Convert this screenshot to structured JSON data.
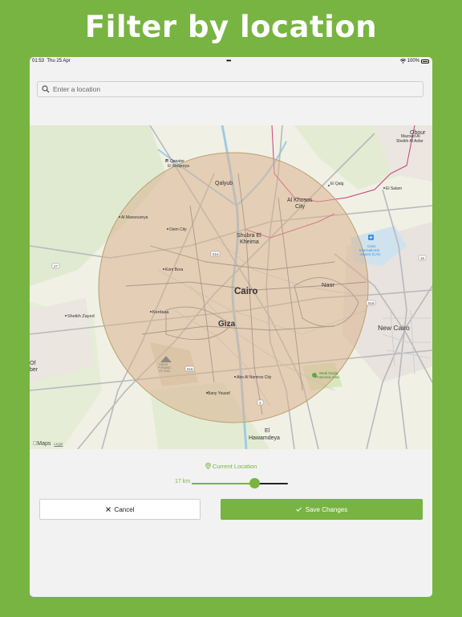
{
  "headline": "Filter by location",
  "status": {
    "time": "01:53",
    "date": "Thu 25 Apr",
    "dots": "•••",
    "battery": "100%"
  },
  "search": {
    "placeholder": "Enter a location",
    "value": ""
  },
  "map": {
    "places": {
      "cairo": "Cairo",
      "giza": "Giza",
      "new_cairo": "New Cairo",
      "nasr": "Nasr",
      "qalyub": "Qalyub",
      "el_khosos_1": "Al Khosos",
      "el_khosos_2": "City",
      "shubra_1": "Shubra El",
      "shubra_2": "Kheima",
      "hawamdeya_1": "El",
      "hawamdeya_2": "Hawamdeya",
      "kerdasa": "Kerdasa",
      "sheikh_zayed": "Sheikh Zayed",
      "obour": "Obour",
      "el_qanater_1": "El Qanater",
      "el_qanater_2": "El Khayreya",
      "al_mansoureya": "Al Mansoureya",
      "osim": "Osim City",
      "kom_bora": "Kom Bora",
      "abo_al_nomros": "Abo Al Nomros City",
      "bany_yousef": "Bany Yousef",
      "el_qalg": "El Qalg",
      "el_salam": "El Salam",
      "mazraet_1": "Mazraet Al",
      "mazraet_2": "Sheikh Al Asfar",
      "airport_1": "Cairo",
      "airport_2": "International",
      "airport_3": "Airport (CAI)",
      "wadi_1": "Wadi Degla",
      "wadi_2": "Protected Area",
      "pyramid_1": "GREAT",
      "pyramid_2": "PYRAMID",
      "pyramid_3": "OF GIZA",
      "of_1": "Of",
      "of_2": "ber"
    },
    "roads": {
      "r27": "27",
      "r516a": "516",
      "r516b": "516",
      "r518": "518",
      "r16": "16",
      "r3": "3"
    },
    "attribution": "Maps",
    "legal": "Legal",
    "colors": {
      "land": "#f1f0e4",
      "urban": "#ebe4dc",
      "park": "#d7e8c0",
      "radius_fill": "#d9b38f",
      "radius_stroke": "#b7a070",
      "road": "#b7b9bd",
      "border": "#cc3c7f",
      "water": "#9ecbe6"
    }
  },
  "filter": {
    "current_location_label": "Current Location",
    "radius_label": "17 km",
    "slider_fraction": 0.65
  },
  "buttons": {
    "cancel": "Cancel",
    "save": "Save Changes"
  },
  "colors": {
    "accent": "#78b441",
    "background": "#f2f2f2"
  }
}
